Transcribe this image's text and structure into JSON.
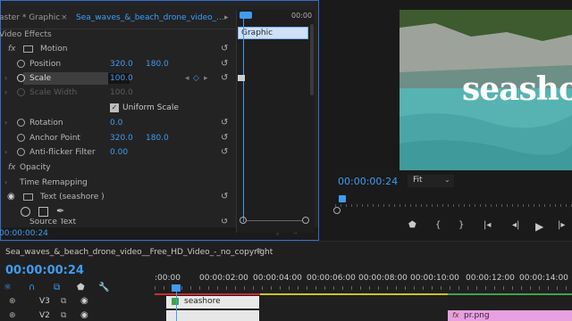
{
  "ect": {
    "source_tab": "aster * Graphic",
    "active_tab": "Sea_waves_&_beach_drone_video_...",
    "section": "Video Effects",
    "motion": "Motion",
    "position": {
      "label": "Position",
      "x": "320.0",
      "y": "180.0"
    },
    "scale": {
      "label": "Scale",
      "value": "100.0"
    },
    "scale_width": {
      "label": "Scale Width",
      "value": "100.0"
    },
    "uniform_scale": "Uniform Scale",
    "rotation": {
      "label": "Rotation",
      "value": "0.0"
    },
    "anchor": {
      "label": "Anchor Point",
      "x": "320.0",
      "y": "180.0"
    },
    "antiflicker": {
      "label": "Anti-flicker Filter",
      "value": "0.00"
    },
    "opacity": "Opacity",
    "time_remap": "Time Remapping",
    "text_layer": "Text (seashore )",
    "source_text": "Source Text",
    "timecode": "00:00:00:24",
    "mini_ruler_end": "00:00",
    "graphic_clip": "Graphic"
  },
  "program": {
    "overlay_text": "seashore",
    "timecode": "00:00:00:24",
    "fit": "Fit"
  },
  "timeline": {
    "sequence_tab": "Sea_waves_&_beach_drone_video__Free_HD_Video_-_no_copyright",
    "timecode": "00:00:00:24",
    "ruler": [
      ":00:00",
      "00:00:02:00",
      "00:00:04:00",
      "00:00:06:00",
      "00:00:08:00",
      "00:00:10:00",
      "00:00:12:00",
      "00:00:14:00"
    ],
    "tracks": [
      {
        "name": "V3",
        "clip": "seashore"
      },
      {
        "name": "V2",
        "clip": "pr.png"
      }
    ]
  },
  "colors": {
    "accent": "#3f9cf1",
    "panel_border": "#2f6fd1",
    "clip_green": "#ffffff",
    "clip_pink": "#e7a1e0",
    "work_area_red": "#cc2e2e",
    "work_area_yellow": "#c9c128"
  }
}
